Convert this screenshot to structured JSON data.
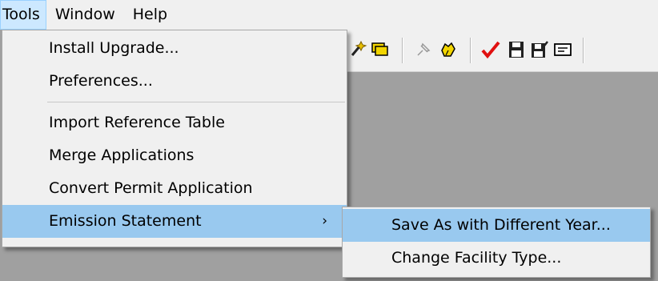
{
  "menubar": {
    "items": [
      "Tools",
      "Window",
      "Help"
    ]
  },
  "tools_menu": {
    "group1": [
      "Install Upgrade...",
      "Preferences..."
    ],
    "group2": [
      "Import Reference Table",
      "Merge Applications",
      "Convert Permit Application"
    ],
    "emission": {
      "label": "Emission Statement",
      "arrow": "›"
    }
  },
  "submenu": {
    "items": [
      "Save As with Different Year...",
      "Change Facility Type..."
    ]
  },
  "toolbar": {
    "icons": [
      "wand-icon",
      "folders-icon",
      "pushpin-icon",
      "hand-icon",
      "checkmark-icon",
      "floppy-disk-icon",
      "floppy-edit-icon",
      "message-icon"
    ],
    "colors": {
      "check": "#e01010",
      "folder": "#f2d500",
      "accent": "#99c9ef"
    }
  }
}
